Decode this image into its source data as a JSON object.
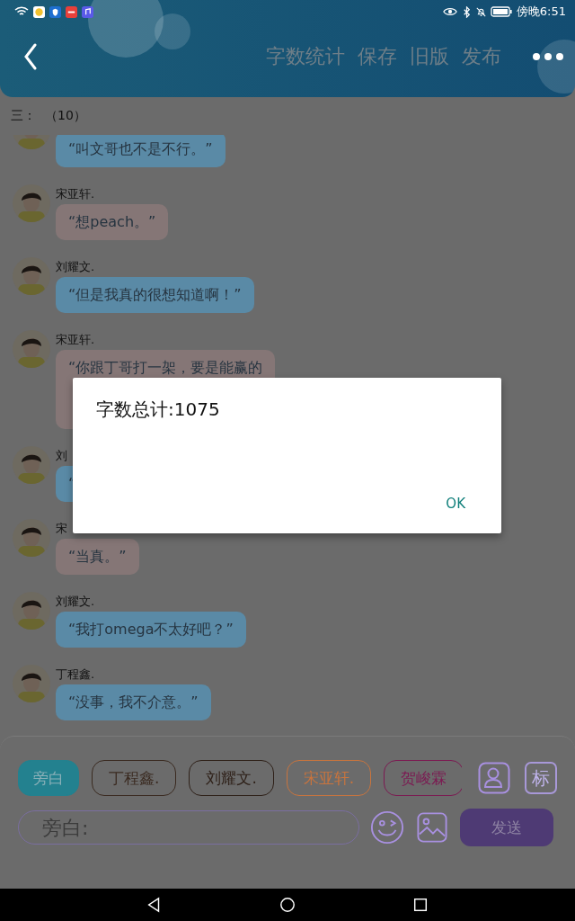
{
  "status_bar": {
    "time": "傍晚6:51"
  },
  "header": {
    "actions": [
      "字数统计",
      "保存",
      "旧版",
      "发布"
    ]
  },
  "subheader": {
    "label": "三：",
    "count": "（10）"
  },
  "messages": [
    {
      "text": [
        "“叫文哥也不是不行。”"
      ],
      "color": "#5a8aa6"
    },
    {
      "name": "宋亚轩.",
      "text": [
        "“想peach。”"
      ],
      "color": "#857676"
    },
    {
      "name": "刘耀文.",
      "text": [
        "“但是我真的很想知道啊！”"
      ],
      "color": "#5a8aa6"
    },
    {
      "name": "宋亚轩.",
      "text": [
        "“你跟丁哥打一架，要是能赢的"
      ],
      "color": "#857676"
    },
    {
      "name": "刘",
      "text": [
        "“"
      ],
      "color": "#5a8aa6"
    },
    {
      "name": "宋",
      "text": [
        "“当真。”"
      ],
      "color": "#857676"
    },
    {
      "name": "刘耀文.",
      "text": [
        "“我打omega不太好吧？”"
      ],
      "color": "#5a8aa6"
    },
    {
      "name": "丁程鑫.",
      "text": [
        "“没事，我不介意。”"
      ],
      "color": "#5a8aa6"
    }
  ],
  "speakers": [
    {
      "label": "旁白",
      "selected": true,
      "color": "#23818f"
    },
    {
      "label": "丁程鑫.",
      "selected": false,
      "color": "#3a2a20"
    },
    {
      "label": "刘耀文.",
      "selected": false,
      "color": "#2e2018"
    },
    {
      "label": "宋亚轩.",
      "selected": false,
      "color": "#c8743e"
    },
    {
      "label": "贺峻霖",
      "selected": false,
      "color": "#7c1a52"
    }
  ],
  "tag_button": "标",
  "input": {
    "placeholder": "旁白:"
  },
  "send_button": "发送",
  "dialog": {
    "message": "字数总计:1075",
    "button": "OK"
  }
}
